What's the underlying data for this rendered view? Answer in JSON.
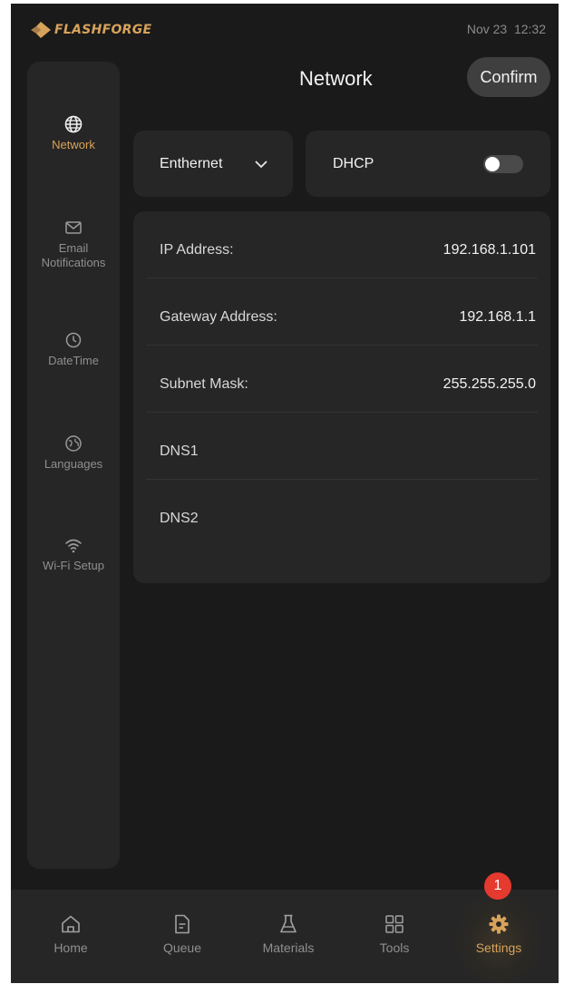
{
  "status_bar": {
    "brand": "FLASHFORGE",
    "datetime": "Nov 23  12:32"
  },
  "sidebar": {
    "items": [
      {
        "label": "Network",
        "icon": "globe-icon",
        "active": true
      },
      {
        "label": "Email\nNotifications",
        "icon": "envelope-icon",
        "active": false
      },
      {
        "label": "DateTime",
        "icon": "clock-icon",
        "active": false
      },
      {
        "label": "Languages",
        "icon": "language-globe-icon",
        "active": false
      },
      {
        "label": "Wi-Fi Setup",
        "icon": "wifi-icon",
        "active": false
      }
    ]
  },
  "header": {
    "title": "Network",
    "confirm_label": "Confirm"
  },
  "connection": {
    "type_selected": "Enthernet",
    "dhcp_label": "DHCP",
    "dhcp_enabled": false
  },
  "fields": [
    {
      "label": "IP Address:",
      "value": "192.168.1.101"
    },
    {
      "label": "Gateway Address:",
      "value": "192.168.1.1"
    },
    {
      "label": "Subnet Mask:",
      "value": "255.255.255.0"
    },
    {
      "label": "DNS1",
      "value": ""
    },
    {
      "label": "DNS2",
      "value": ""
    }
  ],
  "bottom_nav": {
    "items": [
      {
        "label": "Home",
        "icon": "home-icon"
      },
      {
        "label": "Queue",
        "icon": "document-icon"
      },
      {
        "label": "Materials",
        "icon": "flask-icon"
      },
      {
        "label": "Tools",
        "icon": "grid-icon"
      },
      {
        "label": "Settings",
        "icon": "gear-icon",
        "active": true
      }
    ],
    "settings_badge": "1"
  },
  "colors": {
    "accent": "#d7a35a",
    "background": "#1a1a1a",
    "panel": "#262626",
    "badge": "#e53a2f"
  }
}
